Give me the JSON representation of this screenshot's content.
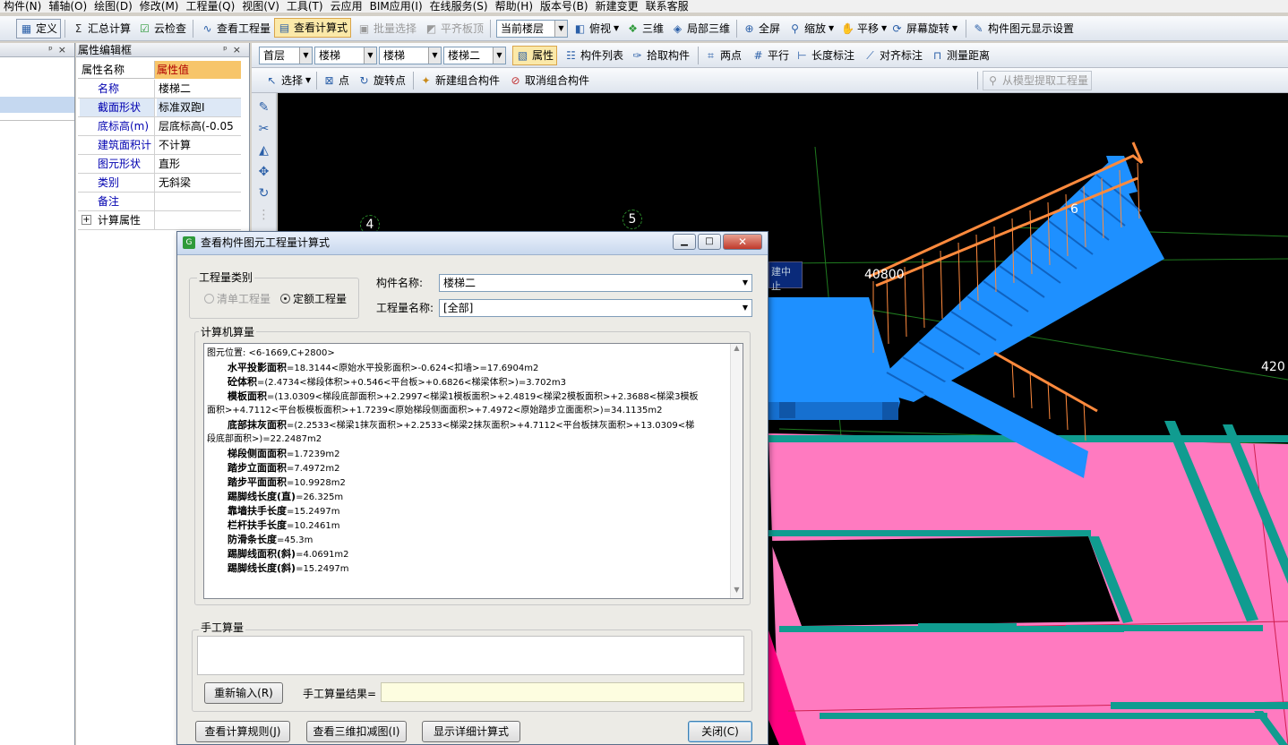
{
  "menu": [
    "构件(N)",
    "辅轴(O)",
    "绘图(D)",
    "修改(M)",
    "工程量(Q)",
    "视图(V)",
    "工具(T)",
    "云应用",
    "BIM应用(I)",
    "在线服务(S)",
    "帮助(H)",
    "版本号(B)",
    "新建变更",
    "联系客服"
  ],
  "toolbar1": {
    "define": "定义",
    "sum_calc": "汇总计算",
    "cloud_check": "云检查",
    "view_qty": "查看工程量",
    "view_formula": "查看计算式",
    "batch_select": "批量选择",
    "level_slab": "平齐板顶",
    "current_floor": "当前楼层",
    "top_view": "俯视",
    "three_d": "三维",
    "local_3d": "局部三维",
    "fullscreen": "全屏",
    "zoom": "缩放",
    "pan": "平移",
    "rotate": "屏幕旋转",
    "display_settings": "构件图元显示设置"
  },
  "toolbar2": {
    "floor": "首层",
    "category": "楼梯",
    "type": "楼梯",
    "component": "楼梯二",
    "properties": "属性",
    "component_list": "构件列表",
    "pick": "拾取构件",
    "two_points": "两点",
    "parallel": "平行",
    "length_dim": "长度标注",
    "align_dim": "对齐标注",
    "measure": "测量距离"
  },
  "toolbar3": {
    "select": "选择",
    "point": "点",
    "rotate_point": "旋转点",
    "new_group": "新建组合构件",
    "cancel_group": "取消组合构件",
    "extract": "从模型提取工程量"
  },
  "prop_panel": {
    "title": "属性编辑框",
    "col_name": "属性名称",
    "col_value": "属性值",
    "rows": [
      {
        "name": "名称",
        "value": "楼梯二"
      },
      {
        "name": "截面形状",
        "value": "标准双跑I"
      },
      {
        "name": "底标高(m)",
        "value": "层底标高(-0.05"
      },
      {
        "name": "建筑面积计",
        "value": "不计算"
      },
      {
        "name": "图元形状",
        "value": "直形"
      },
      {
        "name": "类别",
        "value": "无斜梁"
      },
      {
        "name": "备注",
        "value": ""
      },
      {
        "name": "计算属性",
        "value": ""
      }
    ]
  },
  "viewport": {
    "axis_4": "4",
    "axis_5": "5",
    "axis_6": "6",
    "dim_1": "40800",
    "dim_2": "420",
    "stop_tag": "建中止"
  },
  "dialog": {
    "title": "查看构件图元工程量计算式",
    "qty_type_label": "工程量类别",
    "radio_list": "清单工程量",
    "radio_quota": "定额工程量",
    "comp_name_label": "构件名称:",
    "comp_name_value": "楼梯二",
    "qty_name_label": "工程量名称:",
    "qty_name_value": "[全部]",
    "calc_label": "计算机算量",
    "calc_lines": [
      {
        "bold": "",
        "text": "图元位置: <6-1669,C+2800>"
      },
      {
        "bold": "水平投影面积",
        "text": "=18.3144<原始水平投影面积>-0.624<扣墙>=17.6904m2"
      },
      {
        "bold": "砼体积",
        "text": "=(2.4734<梯段体积>+0.546<平台板>+0.6826<梯梁体积>)=3.702m3"
      },
      {
        "bold": "模板面积",
        "text": "=(13.0309<梯段底部面积>+2.2997<梯梁1模板面积>+2.4819<梯梁2模板面积>+2.3688<梯梁3模板"
      },
      {
        "bold": "",
        "text": "面积>+4.7112<平台板模板面积>+1.7239<原始梯段侧面面积>+7.4972<原始踏步立面面积>)=34.1135m2"
      },
      {
        "bold": "底部抹灰面积",
        "text": "=(2.2533<梯梁1抹灰面积>+2.2533<梯梁2抹灰面积>+4.7112<平台板抹灰面积>+13.0309<梯"
      },
      {
        "bold": "",
        "text": "段底部面积>)=22.2487m2"
      },
      {
        "bold": "梯段侧面面积",
        "text": "=1.7239m2"
      },
      {
        "bold": "踏步立面面积",
        "text": "=7.4972m2"
      },
      {
        "bold": "踏步平面面积",
        "text": "=10.9928m2"
      },
      {
        "bold": "踢脚线长度(直)",
        "text": "=26.325m"
      },
      {
        "bold": "靠墙扶手长度",
        "text": "=15.2497m"
      },
      {
        "bold": "栏杆扶手长度",
        "text": "=10.2461m"
      },
      {
        "bold": "防滑条长度",
        "text": "=45.3m"
      },
      {
        "bold": "踢脚线面积(斜)",
        "text": "=4.0691m2"
      },
      {
        "bold": "踢脚线长度(斜)",
        "text": "=15.2497m"
      }
    ],
    "manual_label": "手工算量",
    "reinput_btn": "重新输入(R)",
    "manual_result_label": "手工算量结果=",
    "rules_btn": "查看计算规则(J)",
    "view3d_btn": "查看三维扣减图(I)",
    "detail_btn": "显示详细计算式",
    "close_btn": "关闭(C)"
  }
}
